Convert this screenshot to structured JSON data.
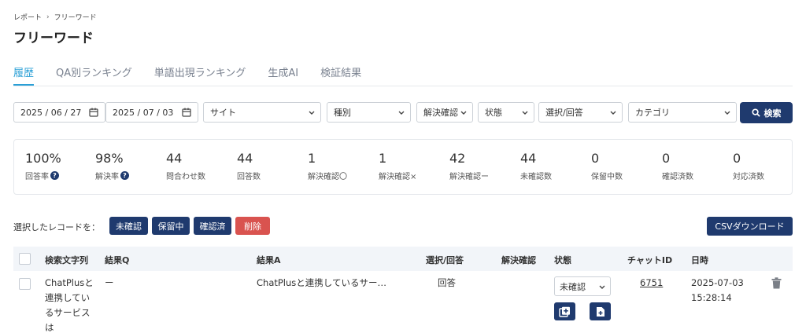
{
  "breadcrumb": {
    "parent": "レポート",
    "separator": "›",
    "current": "フリーワード"
  },
  "page": {
    "title": "フリーワード"
  },
  "tabs": [
    {
      "label": "履歴",
      "active": true
    },
    {
      "label": "QA別ランキング",
      "active": false
    },
    {
      "label": "単語出現ランキング",
      "active": false
    },
    {
      "label": "生成AI",
      "active": false
    },
    {
      "label": "検証結果",
      "active": false
    }
  ],
  "filters": {
    "date_from": "2025 / 06 / 27",
    "date_to": "2025 / 07 / 03",
    "site": "サイト",
    "type": "種別",
    "resolution": "解決確認",
    "state": "状態",
    "select_answer": "選択/回答",
    "category": "カテゴリ",
    "search_label": "検索"
  },
  "stats": [
    {
      "value": "100%",
      "label": "回答率",
      "help": true
    },
    {
      "value": "98%",
      "label": "解決率",
      "help": true
    },
    {
      "value": "44",
      "label": "問合わせ数",
      "help": false
    },
    {
      "value": "44",
      "label": "回答数",
      "help": false
    },
    {
      "value": "1",
      "label": "解決確認〇",
      "help": false
    },
    {
      "value": "1",
      "label": "解決確認×",
      "help": false
    },
    {
      "value": "42",
      "label": "解決確認ー",
      "help": false
    },
    {
      "value": "44",
      "label": "未確認数",
      "help": false
    },
    {
      "value": "0",
      "label": "保留中数",
      "help": false
    },
    {
      "value": "0",
      "label": "確認済数",
      "help": false
    },
    {
      "value": "0",
      "label": "対応済数",
      "help": false
    }
  ],
  "bulk": {
    "label": "選択したレコードを：",
    "unconfirmed": "未確認",
    "pending": "保留中",
    "confirmed": "確認済",
    "delete": "削除"
  },
  "csv_label": "CSVダウンロード",
  "table": {
    "headers": {
      "search_text": "検索文字列",
      "result_q": "結果Q",
      "result_a": "結果A",
      "select_answer": "選択/回答",
      "resolution": "解決確認",
      "status": "状態",
      "chat_id": "チャットID",
      "datetime": "日時"
    },
    "rows": [
      {
        "search_text_lines": [
          "ChatPlusと",
          "連携してい",
          "るサービス",
          "は"
        ],
        "result_q": "ー",
        "result_a": "ChatPlusと連携しているサー…",
        "select_answer": "回答",
        "resolution": "",
        "status": "未確認",
        "chat_id": "6751",
        "date": "2025-07-03",
        "time": "15:28:14"
      }
    ]
  },
  "colors": {
    "accent": "#2a9fd6",
    "navy": "#1f3a6e",
    "danger": "#d9534f"
  }
}
